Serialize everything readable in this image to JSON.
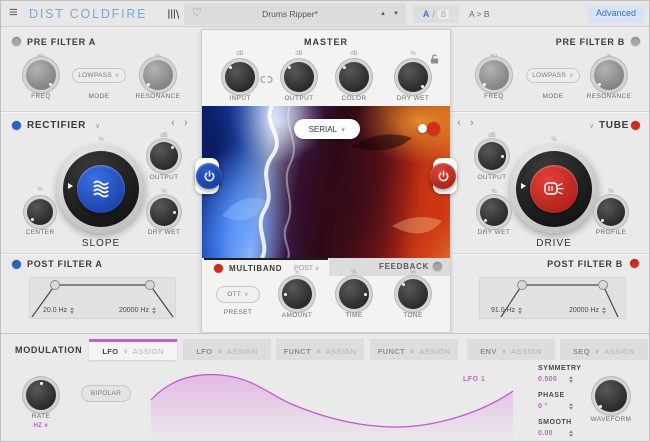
{
  "colors": {
    "logo_blue": "#79a9d9",
    "accent_blue": "#2a62c8",
    "accent_red": "#d12c20",
    "accent_magenta": "#c85fcf",
    "led_off": "#a5a5a5",
    "active_tab_bar": "#bd63d8"
  },
  "icons": {
    "menu": "≡",
    "heart": "♡",
    "up_arrow": "▲",
    "down_arrow": "▼",
    "chevron_down": "∨",
    "nav_prev": "‹",
    "nav_next": "›"
  },
  "header": {
    "logo": "DIST COLDFIRE",
    "preset_name": "Drums Ripper*",
    "ab_a": "A",
    "ab_slash": "/",
    "ab_b": "B",
    "ab_copy": "A > B",
    "advanced": "Advanced"
  },
  "pre_filter_a": {
    "title": "PRE FILTER A",
    "freq": {
      "label": "FREQ",
      "unit": "Hz"
    },
    "mode": {
      "label": "MODE",
      "value": "LOWPASS"
    },
    "resonance": {
      "label": "RESONANCE",
      "unit": "%"
    }
  },
  "pre_filter_b": {
    "title": "PRE FILTER B",
    "freq": {
      "label": "FREQ",
      "unit": "Hz"
    },
    "mode": {
      "label": "MODE",
      "value": "LOWPASS"
    },
    "resonance": {
      "label": "RESONANCE",
      "unit": "%"
    }
  },
  "master": {
    "title": "MASTER",
    "input": {
      "label": "INPUT",
      "unit": "dB"
    },
    "output": {
      "label": "OUTPUT",
      "unit": "dB"
    },
    "color": {
      "label": "COLOR",
      "unit": "dB"
    },
    "dry_wet": {
      "label": "DRY WET",
      "unit": "%"
    }
  },
  "rectifier": {
    "title": "RECTIFIER",
    "slope": {
      "label": "SLOPE",
      "unit": "%"
    },
    "center": {
      "label": "CENTER",
      "unit": "%"
    },
    "output": {
      "label": "OUTPUT",
      "unit": "dB"
    },
    "dry_wet": {
      "label": "DRY WET",
      "unit": "%"
    }
  },
  "tube": {
    "title": "TUBE",
    "drive": {
      "label": "DRIVE",
      "unit": "%"
    },
    "output": {
      "label": "OUTPUT",
      "unit": "dB"
    },
    "dry_wet": {
      "label": "DRY WET",
      "unit": "%"
    },
    "profile": {
      "label": "PROFILE",
      "unit": "%"
    }
  },
  "routing": {
    "value": "SERIAL"
  },
  "multiband": {
    "title": "MULTIBAND",
    "position": "POST",
    "preset": {
      "label": "PRESET",
      "value": "OTT"
    },
    "amount": {
      "label": "AMOUNT",
      "unit": "%"
    },
    "time": {
      "label": "TIME",
      "unit": "%"
    },
    "tone": {
      "label": "TONE",
      "unit": "%"
    }
  },
  "feedback": {
    "title": "FEEDBACK"
  },
  "post_filter_a": {
    "title": "POST FILTER A",
    "low": "20.0 Hz",
    "high": "20000 Hz"
  },
  "post_filter_b": {
    "title": "POST FILTER B",
    "low": "91.0 Hz",
    "high": "20000 Hz"
  },
  "modulation": {
    "title": "MODULATION",
    "tabs": [
      {
        "label": "LFO",
        "assign": "ASSIGN"
      },
      {
        "label": "LFO",
        "assign": "ASSIGN"
      },
      {
        "label": "FUNCT",
        "assign": "ASSIGN"
      },
      {
        "label": "FUNCT",
        "assign": "ASSIGN"
      },
      {
        "label": "ENV",
        "assign": "ASSIGN"
      },
      {
        "label": "SEQ",
        "assign": "ASSIGN"
      }
    ],
    "rate": {
      "label": "RATE",
      "mode": "HZ"
    },
    "bipolar": "BIPOLAR",
    "display_label": "LFO 1",
    "symmetry": {
      "label": "SYMMETRY",
      "value": "0.500"
    },
    "phase": {
      "label": "PHASE",
      "value": "0 °"
    },
    "smooth": {
      "label": "SMOOTH",
      "value": "0.00"
    },
    "waveform": {
      "label": "WAVEFORM"
    }
  }
}
